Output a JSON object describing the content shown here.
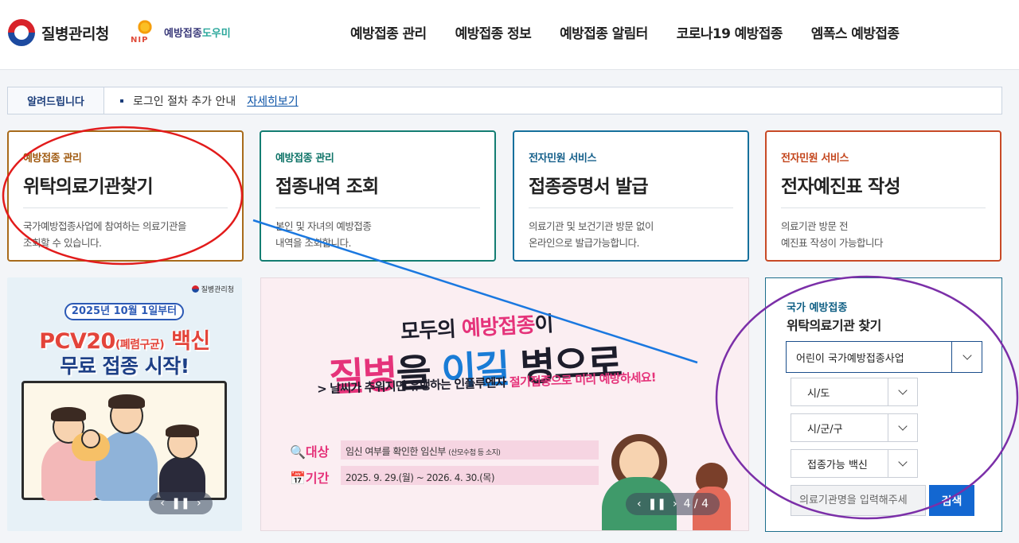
{
  "header": {
    "logo_text": "질병관리청",
    "nip_letters": "NIP",
    "nip_text_a": "예방접종",
    "nip_text_b": "도우미",
    "nav": [
      "예방접종 관리",
      "예방접종 정보",
      "예방접종 알림터",
      "코로나19 예방접종",
      "엠폭스 예방접종"
    ]
  },
  "notice": {
    "label": "알려드립니다",
    "text": "로그인 절차 추가 안내",
    "link": "자세히보기"
  },
  "cards": [
    {
      "category": "예방접종 관리",
      "title": "위탁의료기관찾기",
      "desc1": "국가예방접종사업에 참여하는 의료기관을",
      "desc2": "조회할 수 있습니다."
    },
    {
      "category": "예방접종 관리",
      "title": "접종내역 조회",
      "desc1": "본인 및 자녀의 예방접종",
      "desc2": "내역을 조회합니다."
    },
    {
      "category": "전자민원 서비스",
      "title": "접종증명서 발급",
      "desc1": "의료기관 및 보건기관 방문 없이",
      "desc2": "온라인으로 발급가능합니다."
    },
    {
      "category": "전자민원 서비스",
      "title": "전자예진표 작성",
      "desc1": "의료기관 방문 전",
      "desc2": "예진표 작성이 가능합니다"
    }
  ],
  "banner1": {
    "org": "질병관리청",
    "date": "2025년 10월 1일부터",
    "headline_a": "PCV20",
    "headline_b": "(폐렴구균)",
    "headline_c": "백신",
    "headline2": "무료 접종 시작!"
  },
  "banner2": {
    "line1_a": "모두의 ",
    "line1_b": "예방접종",
    "line1_c": "이",
    "line2_a": "질병",
    "line2_b": "을 ",
    "line2_c": "이길",
    "line2_d": " 병으로",
    "line3_a": "날씨가 추워지면 유행하는 인플루엔자 ",
    "line3_b": "절기접종으로 미리 예방하세요!",
    "target_key": "대상",
    "target_val": "임신 여부를 확인한 임신부",
    "target_note": "(산모수첩 등 소지)",
    "period_key": "기간",
    "period_val": "2025. 9. 29.(월) ~ 2026. 4. 30.(목)",
    "pager": "4 / 4"
  },
  "search": {
    "category": "국가 예방접종",
    "title": "위탁의료기관 찾기",
    "program": "어린이 국가예방접종사업",
    "sido": "시/도",
    "sigungu": "시/군/구",
    "vaccine": "접종가능 백신",
    "input_placeholder": "의료기관명을 입력해주세",
    "button": "검색"
  },
  "annotation_colors": {
    "red": "#e21b1b",
    "blue": "#1a78e0",
    "purple": "#7b2fa8"
  }
}
